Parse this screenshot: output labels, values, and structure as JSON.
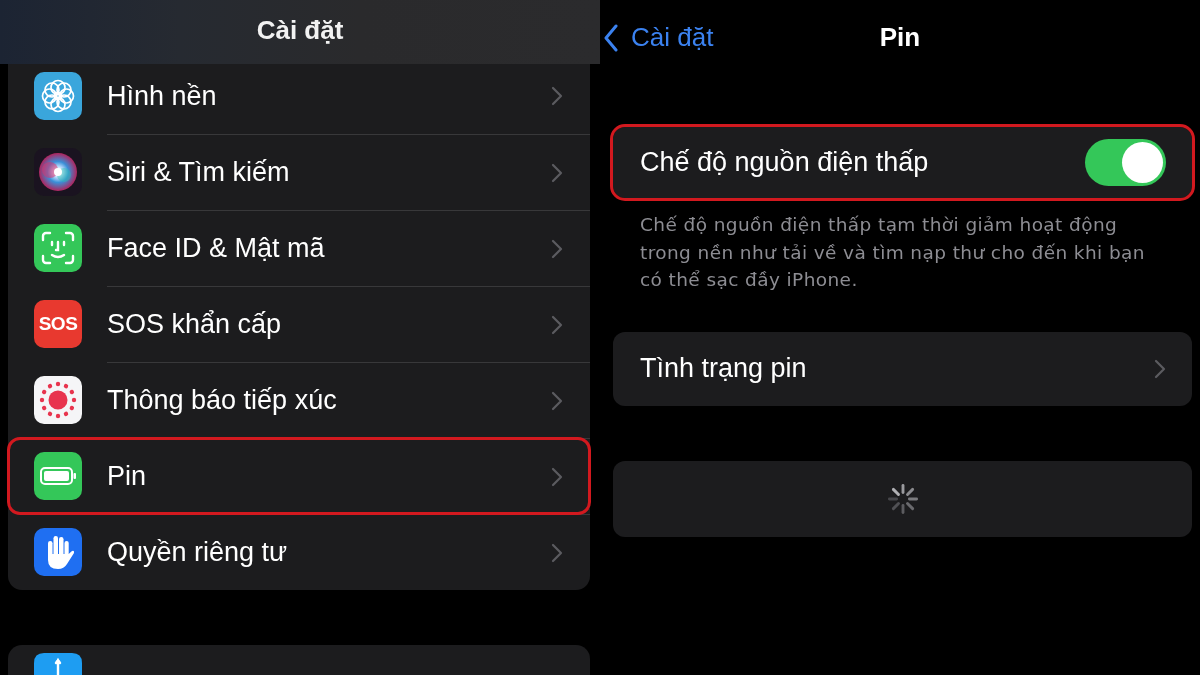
{
  "settings_screen": {
    "title": "Cài đặt",
    "items": [
      {
        "kind": "wallpaper",
        "label": "Hình nền",
        "highlighted": false
      },
      {
        "kind": "siri",
        "label": "Siri & Tìm kiếm",
        "highlighted": false
      },
      {
        "kind": "faceid",
        "label": "Face ID & Mật mã",
        "highlighted": false
      },
      {
        "kind": "sos",
        "label": "SOS khẩn cấp",
        "icon_text": "SOS",
        "highlighted": false
      },
      {
        "kind": "exposure",
        "label": "Thông báo tiếp xúc",
        "highlighted": false
      },
      {
        "kind": "battery",
        "label": "Pin",
        "highlighted": true
      },
      {
        "kind": "privacy",
        "label": "Quyền riêng tư",
        "highlighted": false
      }
    ],
    "next_group": [
      {
        "kind": "appstore"
      }
    ]
  },
  "battery_screen": {
    "back_label": "Cài đặt",
    "title": "Pin",
    "low_power_mode": {
      "label": "Chế độ nguồn điện thấp",
      "on": true,
      "highlighted": true
    },
    "description": "Chế độ nguồn điện thấp tạm thời giảm hoạt động trong nền như tải về và tìm nạp thư cho đến khi bạn có thể sạc đầy iPhone.",
    "rows": [
      {
        "kind": "link",
        "label": "Tình trạng pin"
      },
      {
        "kind": "loading"
      }
    ]
  }
}
